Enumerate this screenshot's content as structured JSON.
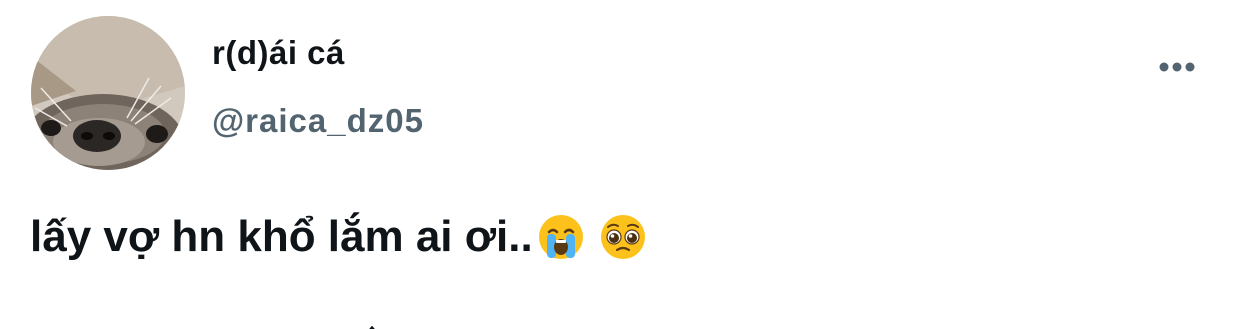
{
  "tweet": {
    "author": {
      "display_name": "r(d)ái cá",
      "handle": "@raica_dz05",
      "avatar_icon": "otter-photo-avatar"
    },
    "more_icon": "ellipsis-icon",
    "text": "lấy vợ hn khổ lắm ai ơi..",
    "emojis": [
      "loudly-crying-face-emoji",
      "pleading-face-emoji"
    ]
  },
  "colors": {
    "text_primary": "#0f1419",
    "text_secondary": "#536471",
    "background": "#ffffff"
  }
}
